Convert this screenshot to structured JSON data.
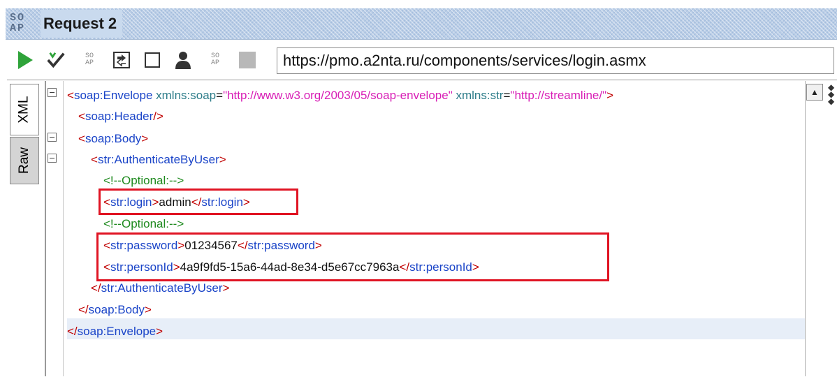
{
  "window": {
    "logo_text_top": "SO",
    "logo_text_bottom": "AP",
    "title": "Request 2"
  },
  "toolbar": {
    "buttons": [
      {
        "name": "run-icon"
      },
      {
        "name": "validate-icon"
      },
      {
        "name": "soap-icon"
      },
      {
        "name": "format-icon"
      },
      {
        "name": "checkbox-icon"
      },
      {
        "name": "user-icon"
      },
      {
        "name": "soap-icon-2"
      },
      {
        "name": "stop-icon"
      }
    ],
    "endpoint_url": "https://pmo.a2nta.ru/components/services/login.asmx"
  },
  "side_tabs": {
    "xml": "XML",
    "raw": "Raw"
  },
  "editor": {
    "line1": {
      "open": "<",
      "tag": "soap:Envelope",
      "attr1_name": " xmlns:soap",
      "eq1": "=",
      "attr1_value": "\"http://www.w3.org/2003/05/soap-envelope\"",
      "attr2_name": " xmlns:str",
      "eq2": "=",
      "attr2_value": "\"http://streamline/\"",
      "close": ">"
    },
    "line2": {
      "open": "<",
      "tag": "soap:Header",
      "close": "/>"
    },
    "line3": {
      "open": "<",
      "tag": "soap:Body",
      "close": ">"
    },
    "line4": {
      "open": "<",
      "tag": "str:AuthenticateByUser",
      "close": ">"
    },
    "line5": {
      "comment": "<!--Optional:-->"
    },
    "line6": {
      "open": "<",
      "tag": "str:login",
      "close": ">",
      "value": "admin",
      "end_open": "</",
      "end_tag": "str:login",
      "end_close": ">"
    },
    "line7": {
      "comment": "<!--Optional:-->"
    },
    "line8": {
      "open": "<",
      "tag": "str:password",
      "close": ">",
      "value": "01234567",
      "end_open": "</",
      "end_tag": "str:password",
      "end_close": ">"
    },
    "line9": {
      "open": "<",
      "tag": "str:personId",
      "close": ">",
      "value": "4a9f9fd5-15a6-44ad-8e34-d5e67cc7963a",
      "end_open": "</",
      "end_tag": "str:personId",
      "end_close": ">"
    },
    "line10": {
      "open": "</",
      "tag": "str:AuthenticateByUser",
      "close": ">"
    },
    "line11": {
      "open": "</",
      "tag": "soap:Body",
      "close": ">"
    },
    "line12": {
      "open": "</",
      "tag": "soap:Envelope",
      "close": ">"
    }
  },
  "colors": {
    "highlight_box": "#e01423",
    "tag_bracket": "#c00000",
    "tag_name": "#1a44c8",
    "attr_value": "#d81fb6",
    "comment": "#1e8a1e"
  }
}
